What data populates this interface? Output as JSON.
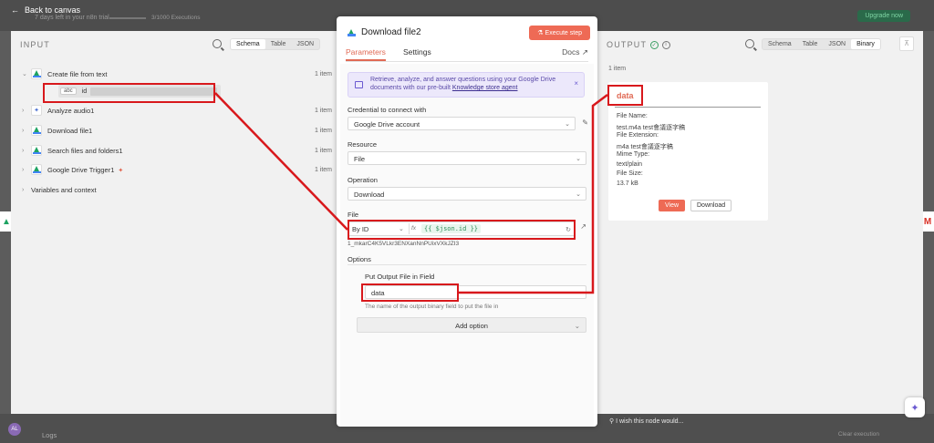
{
  "topbar": {
    "back_label": "Back to canvas",
    "trial_text": "7 days left in your n8n trial",
    "executions": "3/1000 Executions",
    "upgrade_label": "Upgrade now"
  },
  "input": {
    "title": "INPUT",
    "views": [
      "Schema",
      "Table",
      "JSON"
    ],
    "active_view": "Schema",
    "nodes": [
      {
        "label": "Create file from text",
        "count": "1 item"
      },
      {
        "label": "Analyze audio1",
        "count": "1 item"
      },
      {
        "label": "Download file1",
        "count": "1 item"
      },
      {
        "label": "Search files and folders1",
        "count": "1 item"
      },
      {
        "label": "Google Drive Trigger1",
        "count": "1 item"
      }
    ],
    "field_type": "abc",
    "field_key": "id",
    "variables_label": "Variables and context"
  },
  "node": {
    "title": "Download file2",
    "execute_label": "Execute step",
    "tabs": [
      "Parameters",
      "Settings"
    ],
    "docs_label": "Docs",
    "banner_text": "Retrieve, analyze, and answer questions using your Google Drive documents with our pre-built",
    "banner_link": "Knowledge store agent",
    "credential_label": "Credential to connect with",
    "credential_value": "Google Drive account",
    "resource_label": "Resource",
    "resource_value": "File",
    "operation_label": "Operation",
    "operation_value": "Download",
    "file_label": "File",
    "file_mode": "By ID",
    "fx_label": "fx",
    "file_expression": "{{ $json.id }}",
    "file_resolved": "1_mkarC4K5VLkr3ENXanNnPUixVXkJZI3",
    "options_label": "Options",
    "put_output_label": "Put Output File in Field",
    "put_output_value": "data",
    "put_output_hint": "The name of the output binary field to put the file in",
    "add_option_label": "Add option"
  },
  "output": {
    "title": "OUTPUT",
    "views": [
      "Schema",
      "Table",
      "JSON",
      "Binary"
    ],
    "active_view": "Binary",
    "item_count": "1 item",
    "binary": {
      "field": "data",
      "file_name_label": "File Name:",
      "file_name": "test.m4a test會議逐字稿",
      "file_ext_label": "File Extension:",
      "file_ext": "m4a test會議逐字稿",
      "mime_label": "Mime Type:",
      "mime": "text/plain",
      "size_label": "File Size:",
      "size": "13.7 kB",
      "view_label": "View",
      "download_label": "Download"
    }
  },
  "footer": {
    "logs_label": "Logs",
    "wish_label": "I wish this node would...",
    "clear_label": "Clear execution",
    "avatar_initials": "AL"
  },
  "colors": {
    "accent": "#ee6a55",
    "annotation": "#d8181c",
    "success": "#3b9e63"
  }
}
